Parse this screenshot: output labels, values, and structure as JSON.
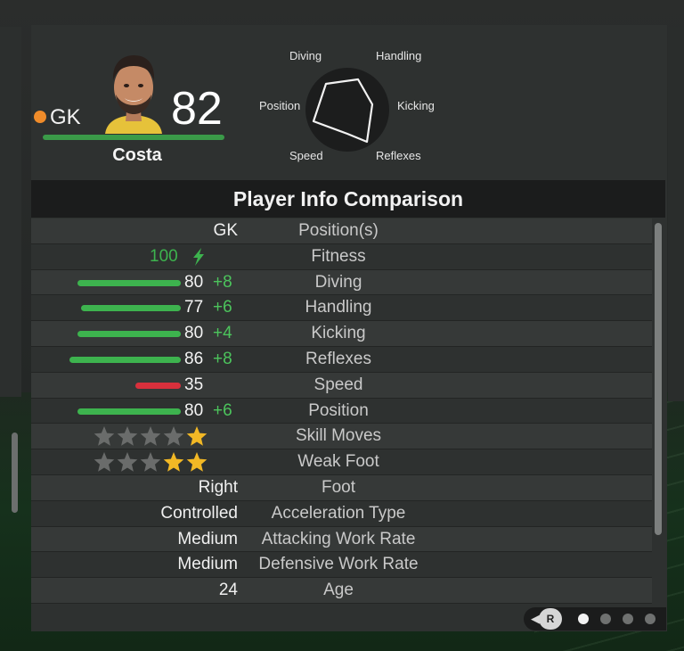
{
  "player": {
    "position": "GK",
    "rating": "82",
    "name": "Costa"
  },
  "radar": {
    "labels": {
      "diving": "Diving",
      "handling": "Handling",
      "position": "Position",
      "kicking": "Kicking",
      "speed": "Speed",
      "reflexes": "Reflexes"
    }
  },
  "comparison": {
    "title": "Player Info Comparison",
    "rows": [
      {
        "label": "Position(s)",
        "value": "GK"
      },
      {
        "label": "Fitness",
        "value": "100"
      },
      {
        "label": "Diving",
        "value": "80",
        "delta": "+8",
        "bar_color": "#3db34e"
      },
      {
        "label": "Handling",
        "value": "77",
        "delta": "+6",
        "bar_color": "#3db34e"
      },
      {
        "label": "Kicking",
        "value": "80",
        "delta": "+4",
        "bar_color": "#3db34e"
      },
      {
        "label": "Reflexes",
        "value": "86",
        "delta": "+8",
        "bar_color": "#3db34e"
      },
      {
        "label": "Speed",
        "value": "35",
        "delta": "",
        "bar_color": "#d8303c"
      },
      {
        "label": "Position",
        "value": "80",
        "delta": "+6",
        "bar_color": "#3db34e"
      },
      {
        "label": "Skill Moves",
        "stars_filled": 1,
        "stars_total": 5
      },
      {
        "label": "Weak Foot",
        "stars_filled": 2,
        "stars_total": 5
      },
      {
        "label": "Foot",
        "value": "Right"
      },
      {
        "label": "Acceleration Type",
        "value": "Controlled"
      },
      {
        "label": "Attacking Work Rate",
        "value": "Medium"
      },
      {
        "label": "Defensive Work Rate",
        "value": "Medium"
      },
      {
        "label": "Age",
        "value": "24"
      }
    ]
  },
  "footer": {
    "button": "R",
    "pages": 4,
    "active_page": 1
  },
  "colors": {
    "accent_green": "#3db34e",
    "low_stat_red": "#d8303c",
    "position_dot": "#f08c2a",
    "star_gold": "#f2b825"
  }
}
